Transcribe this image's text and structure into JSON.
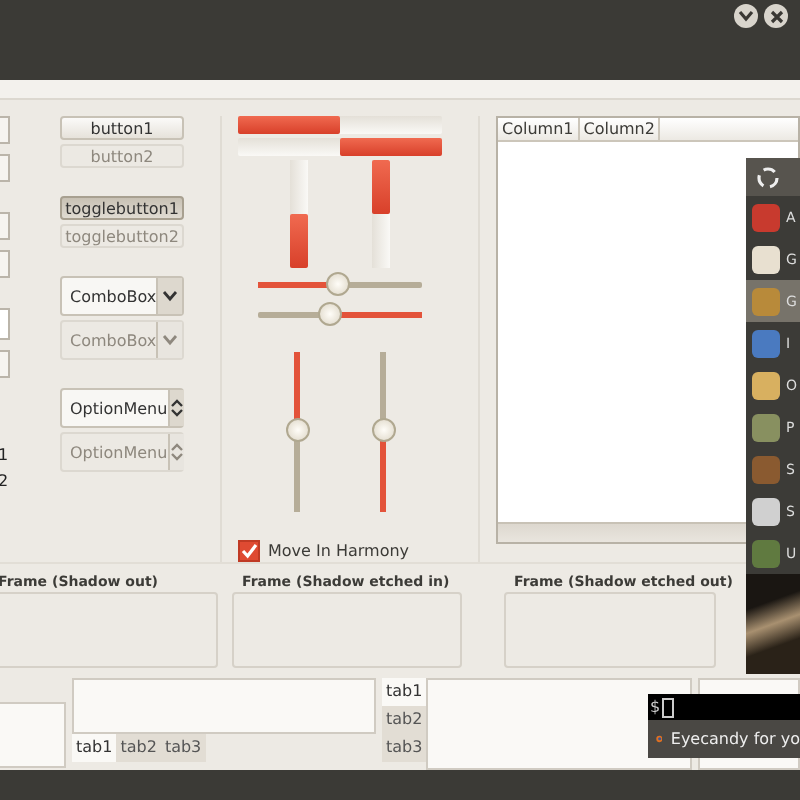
{
  "left_strip": {
    "labels": [
      "1",
      "2"
    ]
  },
  "buttons": [
    {
      "kind": "button",
      "label": "button1",
      "disabled": false
    },
    {
      "kind": "button",
      "label": "button2",
      "disabled": true
    },
    {
      "kind": "toggle",
      "label": "togglebutton1",
      "disabled": false,
      "pressed": true
    },
    {
      "kind": "toggle",
      "label": "togglebutton2",
      "disabled": true,
      "pressed": false
    },
    {
      "kind": "combo",
      "label": "ComboBox",
      "disabled": false
    },
    {
      "kind": "combo",
      "label": "ComboBox",
      "disabled": true
    },
    {
      "kind": "option",
      "label": "OptionMenu",
      "disabled": false
    },
    {
      "kind": "option",
      "label": "OptionMenu",
      "disabled": true
    }
  ],
  "progress_h": [
    {
      "level": 0.5,
      "inverted": false
    },
    {
      "level": 0.5,
      "inverted": true
    }
  ],
  "progress_v": [
    {
      "level": 0.5,
      "inverted": false
    },
    {
      "level": 0.5,
      "inverted": true
    }
  ],
  "scales_h": [
    {
      "level": 0.5,
      "inverted": false
    },
    {
      "level": 0.45,
      "inverted": true
    }
  ],
  "scales_v": [
    {
      "level": 0.5,
      "inverted": false
    },
    {
      "level": 0.5,
      "inverted": true
    }
  ],
  "harmony": {
    "label": "Move In Harmony",
    "checked": true
  },
  "tree": {
    "columns": [
      "Column1",
      "Column2"
    ]
  },
  "menu": {
    "items": [
      {
        "label": "A",
        "selected": false
      },
      {
        "label": "G",
        "selected": false
      },
      {
        "label": "G",
        "selected": true
      },
      {
        "label": "I",
        "selected": false
      },
      {
        "label": "O",
        "selected": false
      },
      {
        "label": "P",
        "selected": false
      },
      {
        "label": "S",
        "selected": false
      },
      {
        "label": "S",
        "selected": false
      },
      {
        "label": "U",
        "selected": false
      }
    ]
  },
  "frames": [
    "Frame (Shadow out)",
    "Frame (Shadow etched in)",
    "Frame (Shadow etched out)"
  ],
  "notebooks": [
    {
      "kind": "bottom",
      "tabs": [
        {
          "label": "tab1",
          "selected": true
        },
        {
          "label": "tab2",
          "selected": false
        },
        {
          "label": "tab3",
          "selected": false
        }
      ]
    },
    {
      "kind": "left",
      "tabs": [
        {
          "label": "tab1",
          "selected": true
        },
        {
          "label": "tab2",
          "selected": false
        },
        {
          "label": "tab3",
          "selected": false
        }
      ]
    }
  ],
  "notification": {
    "prompt": "$",
    "text": "Eyecandy for yo"
  }
}
